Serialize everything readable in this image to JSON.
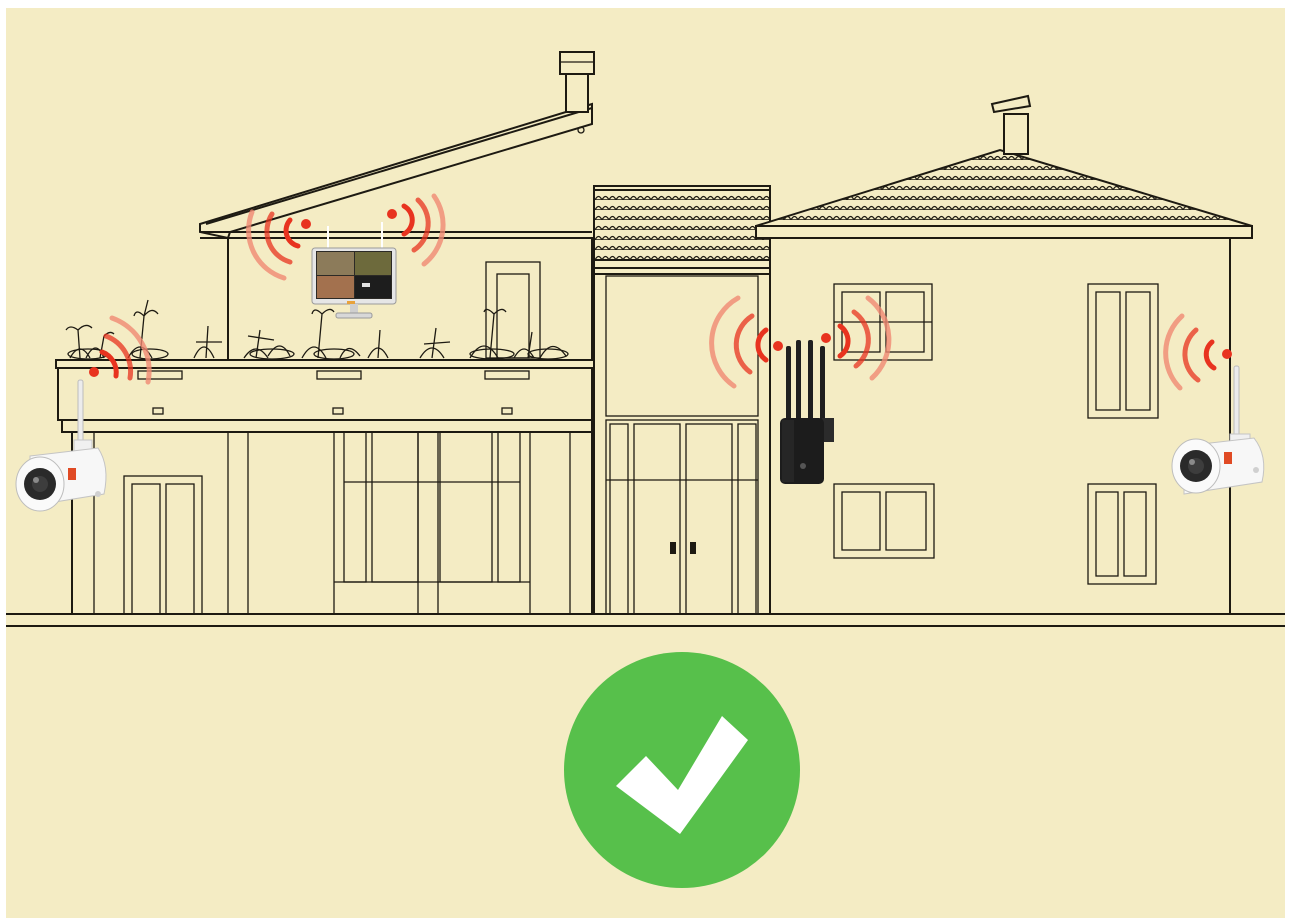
{
  "scene": {
    "background_color": "#f4ecc4",
    "line_color": "#1d1a12",
    "signal_color": "#e8331f",
    "signal_color_soft": "#f08a73"
  },
  "devices": [
    {
      "id": "camera-left",
      "icon": "wifi-camera-icon"
    },
    {
      "id": "nvr-monitor",
      "icon": "monitor-icon"
    },
    {
      "id": "wifi-repeater",
      "icon": "router-icon"
    },
    {
      "id": "camera-right",
      "icon": "wifi-camera-icon"
    }
  ],
  "status": {
    "icon": "checkmark-icon",
    "color": "#57c04b"
  }
}
